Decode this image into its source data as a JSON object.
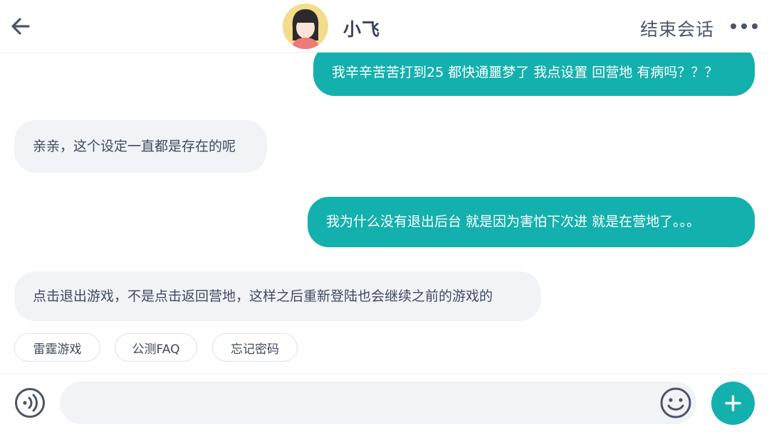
{
  "header": {
    "agent_name": "小飞",
    "end_chat_label": "结束会话",
    "back_icon": "back-arrow-icon",
    "more_icon": "more-dots-icon"
  },
  "messages": [
    {
      "role": "user",
      "text": "我辛辛苦苦打到25 都快通噩梦了 我点设置 回营地 有病吗？？？"
    },
    {
      "role": "agent",
      "text": "亲亲，这个设定一直都是存在的呢"
    },
    {
      "role": "user",
      "text": "我为什么没有退出后台 就是因为害怕下次进 就是在营地了。。。"
    },
    {
      "role": "agent",
      "text": "点击退出游戏，不是点击返回营地，这样之后重新登陆也会继续之前的游戏的"
    }
  ],
  "quick_replies": [
    "雷霆游戏",
    "公测FAQ",
    "忘记密码"
  ],
  "input": {
    "value": "",
    "voice_icon": "voice-icon",
    "emoji_icon": "emoji-icon",
    "plus_icon": "plus-icon"
  },
  "colors": {
    "accent": "#14b0ad",
    "bubble_agent": "#f1f3f6",
    "text_dark": "#3f4a5c"
  }
}
